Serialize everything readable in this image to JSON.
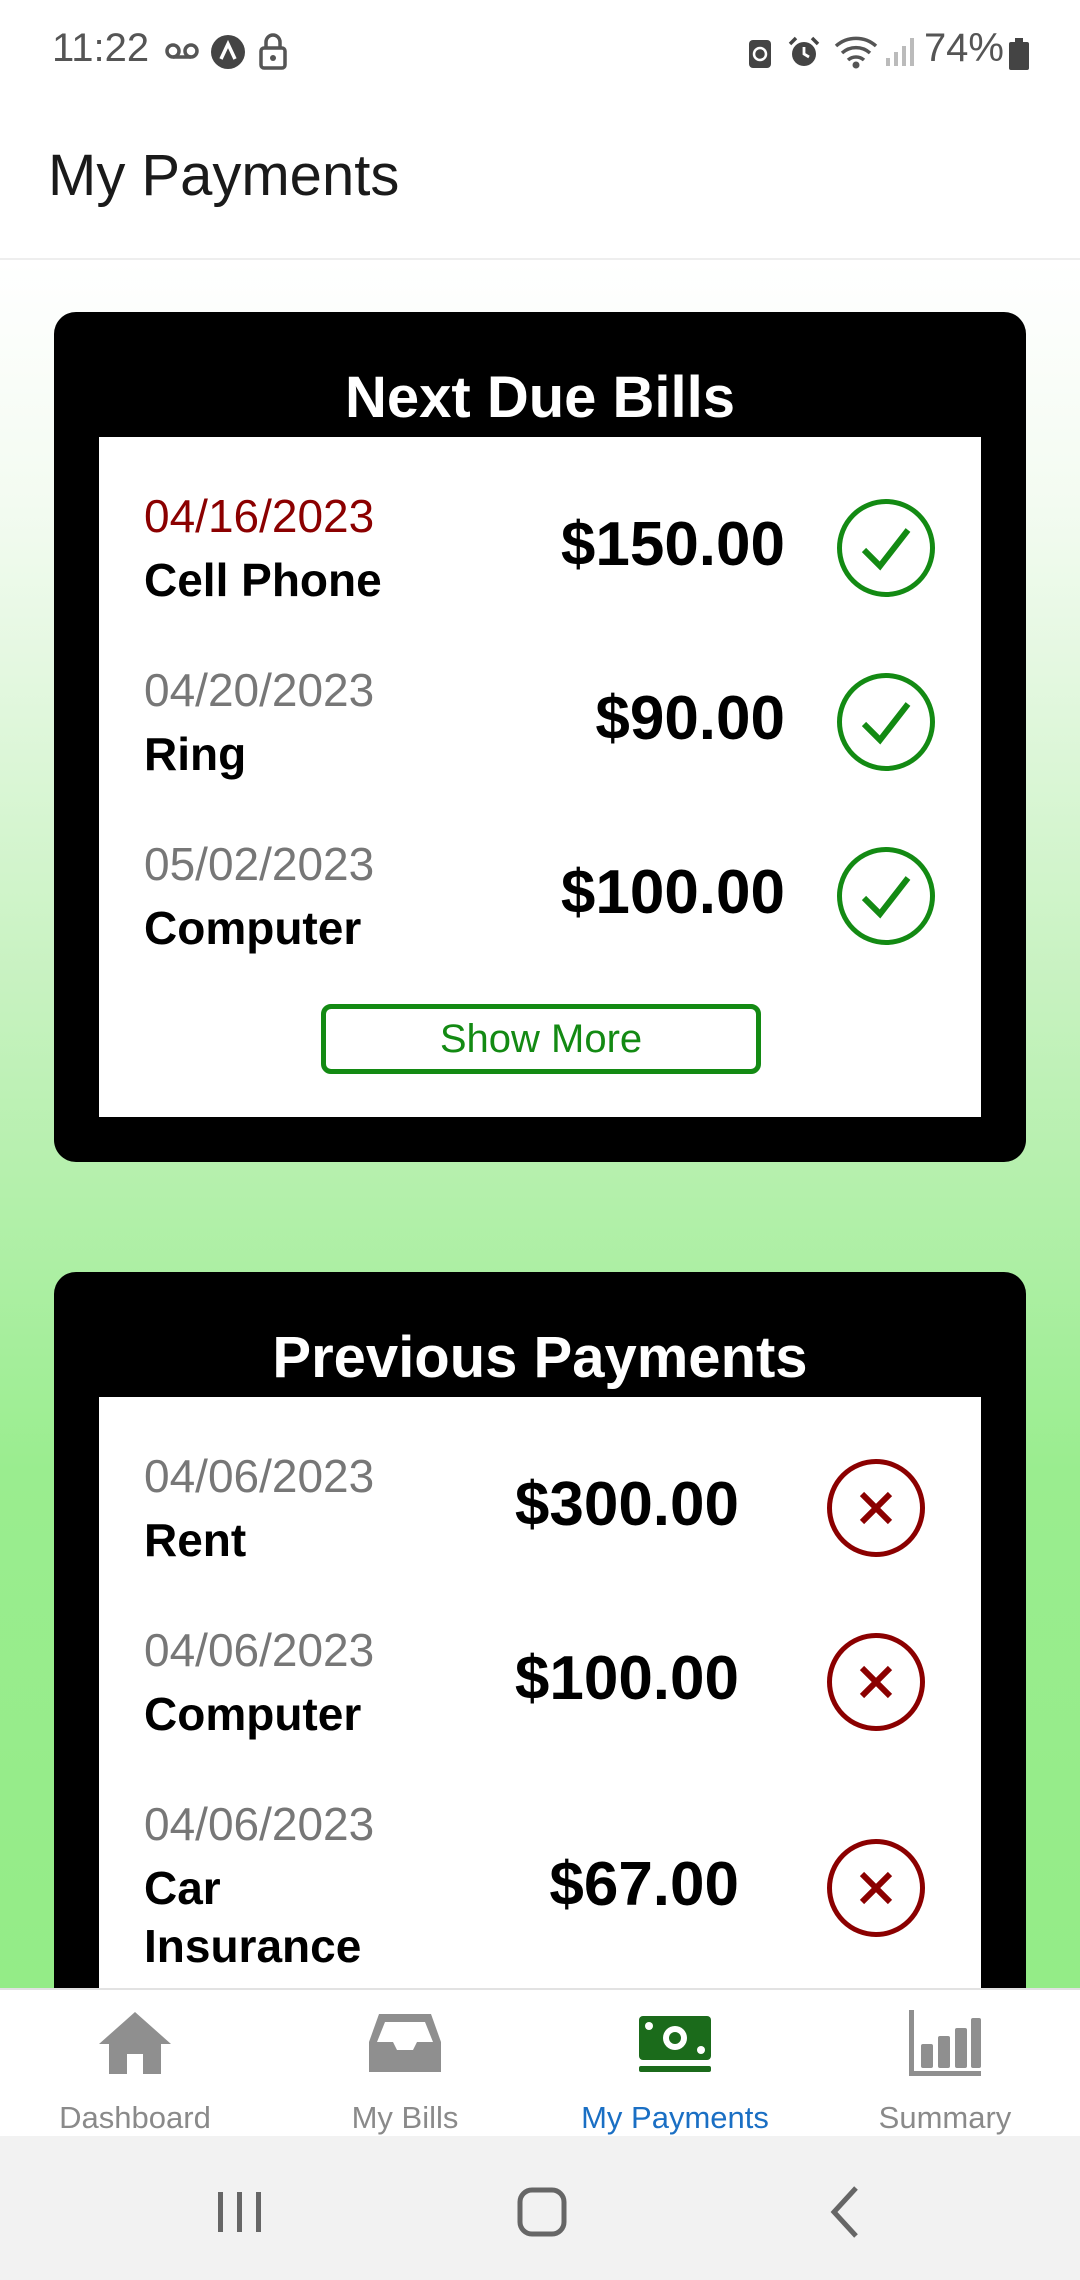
{
  "status_bar": {
    "time": "11:22",
    "battery": "74%"
  },
  "header": {
    "title": "My Payments"
  },
  "next_due": {
    "title": "Next Due Bills",
    "items": [
      {
        "date": "04/16/2023",
        "name": "Cell Phone",
        "amount": "$150.00"
      },
      {
        "date": "04/20/2023",
        "name": "Ring",
        "amount": "$90.00"
      },
      {
        "date": "05/02/2023",
        "name": "Computer",
        "amount": "$100.00"
      }
    ],
    "show_more": "Show More"
  },
  "previous": {
    "title": "Previous Payments",
    "items": [
      {
        "date": "04/06/2023",
        "name": "Rent",
        "amount": "$300.00"
      },
      {
        "date": "04/06/2023",
        "name": "Computer",
        "amount": "$100.00"
      },
      {
        "date": "04/06/2023",
        "name": "Car Insurance",
        "amount": "$67.00"
      }
    ]
  },
  "nav": {
    "items": [
      {
        "label": "Dashboard",
        "icon": "home-icon"
      },
      {
        "label": "My Bills",
        "icon": "inbox-icon"
      },
      {
        "label": "My Payments",
        "icon": "money-icon"
      },
      {
        "label": "Summary",
        "icon": "bar-chart-icon"
      }
    ],
    "active": "My Payments"
  },
  "colors": {
    "paid": "#138a13",
    "unpaid": "#8b0000",
    "active_nav": "#1a6fc4",
    "overdue_date": "#8b0000"
  }
}
